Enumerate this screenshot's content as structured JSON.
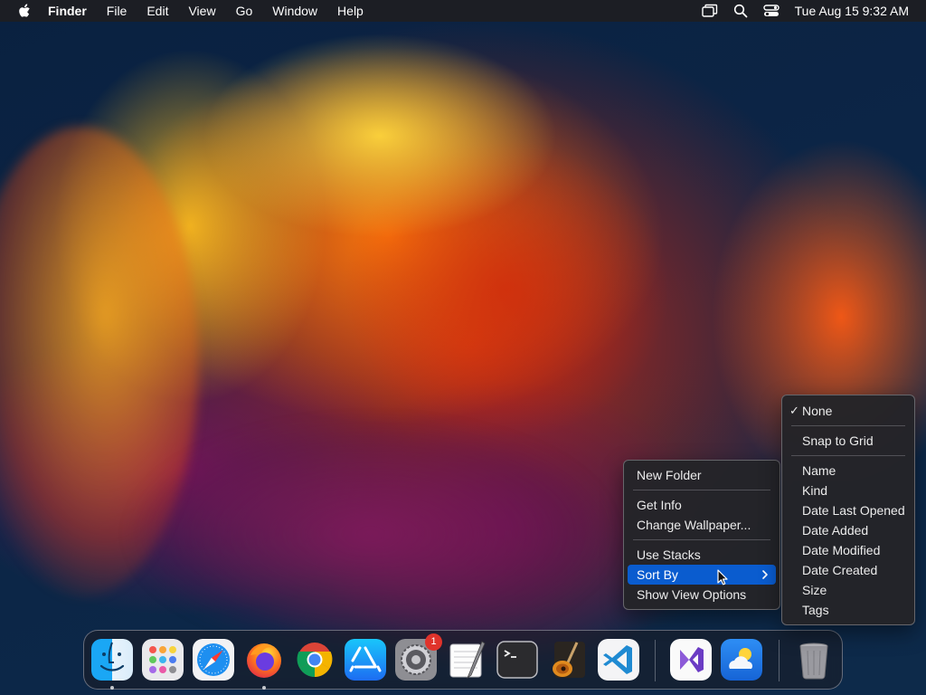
{
  "menubar": {
    "app_name": "Finder",
    "menus": [
      "File",
      "Edit",
      "View",
      "Go",
      "Window",
      "Help"
    ],
    "clock": "Tue Aug 15  9:32 AM"
  },
  "context_menu": {
    "items": {
      "new_folder": "New Folder",
      "get_info": "Get Info",
      "change_wallpaper": "Change Wallpaper...",
      "use_stacks": "Use Stacks",
      "sort_by": "Sort By",
      "show_view_options": "Show View Options"
    },
    "highlighted": "Sort By"
  },
  "sort_submenu": {
    "selected": "None",
    "items": {
      "none": "None",
      "snap_to_grid": "Snap to Grid",
      "name": "Name",
      "kind": "Kind",
      "date_last_opened": "Date Last Opened",
      "date_added": "Date Added",
      "date_modified": "Date Modified",
      "date_created": "Date Created",
      "size": "Size",
      "tags": "Tags"
    }
  },
  "dock": {
    "apps": [
      {
        "icon": "finder-icon",
        "running": true
      },
      {
        "icon": "launchpad-icon",
        "running": false
      },
      {
        "icon": "safari-icon",
        "running": false
      },
      {
        "icon": "firefox-icon",
        "running": true
      },
      {
        "icon": "chrome-icon",
        "running": false
      },
      {
        "icon": "app-store-icon",
        "running": false
      },
      {
        "icon": "system-settings-icon",
        "running": false
      },
      {
        "icon": "textedit-icon",
        "running": false
      },
      {
        "icon": "terminal-icon",
        "running": false
      },
      {
        "icon": "garageband-icon",
        "running": false
      },
      {
        "icon": "vscode-icon",
        "running": false
      },
      {
        "icon": "visual-studio-icon",
        "running": false
      },
      {
        "icon": "weather-icon",
        "running": false
      },
      {
        "icon": "trash-icon",
        "running": false
      }
    ],
    "settings_badge": "1"
  },
  "colors": {
    "menu_highlight": "#0a5ccf",
    "badge": "#e0332b"
  }
}
